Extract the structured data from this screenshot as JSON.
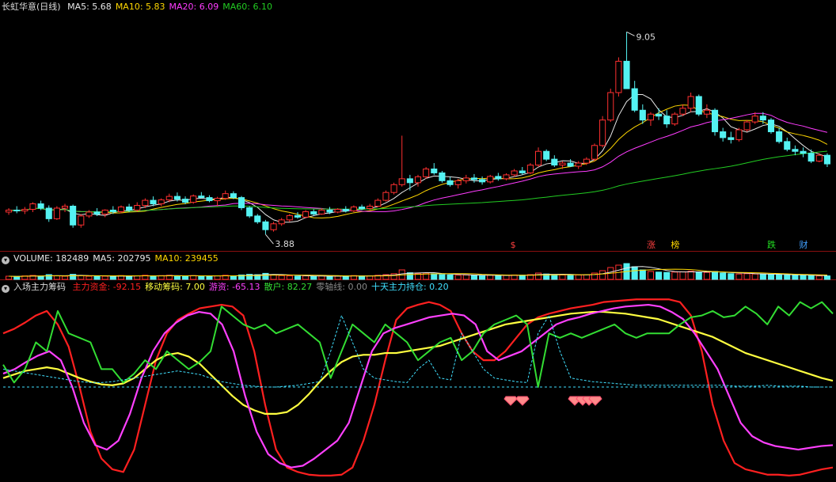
{
  "price_panel": {
    "title": "长虹华意(日线)",
    "indicators": [
      {
        "label": "MA5: 5.68",
        "color": "#e8e8e8"
      },
      {
        "label": "MA10: 5.83",
        "color": "#ffd700"
      },
      {
        "label": "MA20: 6.09",
        "color": "#ff3cff"
      },
      {
        "label": "MA60: 6.10",
        "color": "#22cc22"
      }
    ],
    "high_label": "9.05",
    "low_label": "3.88",
    "markers": [
      {
        "text": "$",
        "color": "#ff4040"
      },
      {
        "text": "涨",
        "color": "#ff4040"
      },
      {
        "text": "榜",
        "color": "#ffd700"
      },
      {
        "text": "跌",
        "color": "#22dd22"
      },
      {
        "text": "财",
        "color": "#40a0ff"
      }
    ]
  },
  "volume_panel": {
    "items": [
      {
        "label": "VOLUME: 182489",
        "color": "#e8e8e8"
      },
      {
        "label": "MA5: 202795",
        "color": "#e8e8e8"
      },
      {
        "label": "MA10: 239455",
        "color": "#ffd700"
      }
    ]
  },
  "indicator_panel": {
    "title": "入场主力筹码",
    "items": [
      {
        "label": "主力资金: -92.15",
        "color": "#ff2020"
      },
      {
        "label": "移动筹码: 7.00",
        "color": "#ffff40"
      },
      {
        "label": "游资: -65.13",
        "color": "#ff40ff"
      },
      {
        "label": "散户: 82.27",
        "color": "#33dd33"
      },
      {
        "label": "零轴线: 0.00",
        "color": "#888888"
      },
      {
        "label": "十天主力持仓: 0.20",
        "color": "#40e0ff"
      }
    ]
  },
  "colors": {
    "up": "#ff3030",
    "down": "#54f2f2",
    "background": "#000000",
    "separator": "#8a1010"
  },
  "chart_data": [
    {
      "type": "candlestick",
      "name": "price",
      "ylim": [
        3.6,
        9.5
      ],
      "candles_ohlc_approx": [
        [
          4.45,
          4.55,
          4.38,
          4.5
        ],
        [
          4.5,
          4.6,
          4.42,
          4.48
        ],
        [
          4.48,
          4.58,
          4.4,
          4.52
        ],
        [
          4.52,
          4.7,
          4.45,
          4.66
        ],
        [
          4.66,
          4.74,
          4.5,
          4.55
        ],
        [
          4.55,
          4.62,
          4.2,
          4.28
        ],
        [
          4.28,
          4.6,
          4.25,
          4.55
        ],
        [
          4.55,
          4.66,
          4.45,
          4.6
        ],
        [
          4.6,
          4.64,
          4.05,
          4.12
        ],
        [
          4.12,
          4.4,
          4.05,
          4.35
        ],
        [
          4.35,
          4.5,
          4.3,
          4.45
        ],
        [
          4.45,
          4.55,
          4.35,
          4.4
        ],
        [
          4.4,
          4.52,
          4.32,
          4.5
        ],
        [
          4.5,
          4.6,
          4.4,
          4.46
        ],
        [
          4.46,
          4.62,
          4.42,
          4.58
        ],
        [
          4.58,
          4.66,
          4.45,
          4.5
        ],
        [
          4.5,
          4.7,
          4.46,
          4.62
        ],
        [
          4.62,
          4.8,
          4.55,
          4.75
        ],
        [
          4.75,
          4.85,
          4.6,
          4.66
        ],
        [
          4.66,
          4.8,
          4.6,
          4.76
        ],
        [
          4.76,
          4.92,
          4.7,
          4.85
        ],
        [
          4.85,
          4.95,
          4.72,
          4.78
        ],
        [
          4.78,
          4.85,
          4.65,
          4.7
        ],
        [
          4.7,
          4.9,
          4.66,
          4.86
        ],
        [
          4.86,
          4.96,
          4.8,
          4.82
        ],
        [
          4.82,
          4.88,
          4.7,
          4.74
        ],
        [
          4.74,
          4.84,
          4.6,
          4.8
        ],
        [
          4.8,
          5.0,
          4.76,
          4.92
        ],
        [
          4.92,
          4.98,
          4.78,
          4.82
        ],
        [
          4.82,
          4.86,
          4.5,
          4.56
        ],
        [
          4.56,
          4.6,
          4.3,
          4.35
        ],
        [
          4.35,
          4.4,
          4.15,
          4.2
        ],
        [
          4.2,
          4.25,
          3.88,
          4.0
        ],
        [
          4.0,
          4.2,
          3.95,
          4.15
        ],
        [
          4.15,
          4.3,
          4.1,
          4.25
        ],
        [
          4.25,
          4.4,
          4.2,
          4.36
        ],
        [
          4.36,
          4.45,
          4.28,
          4.32
        ],
        [
          4.32,
          4.5,
          4.3,
          4.46
        ],
        [
          4.46,
          4.52,
          4.35,
          4.4
        ],
        [
          4.4,
          4.55,
          4.38,
          4.5
        ],
        [
          4.5,
          4.58,
          4.4,
          4.45
        ],
        [
          4.45,
          4.55,
          4.42,
          4.52
        ],
        [
          4.52,
          4.6,
          4.44,
          4.48
        ],
        [
          4.48,
          4.62,
          4.45,
          4.58
        ],
        [
          4.58,
          4.64,
          4.5,
          4.54
        ],
        [
          4.54,
          4.66,
          4.5,
          4.6
        ],
        [
          4.6,
          4.8,
          4.58,
          4.75
        ],
        [
          4.75,
          5.0,
          4.72,
          4.95
        ],
        [
          4.95,
          5.2,
          4.9,
          5.15
        ],
        [
          5.15,
          6.4,
          5.1,
          5.3
        ],
        [
          5.3,
          5.4,
          5.0,
          5.2
        ],
        [
          5.2,
          5.4,
          5.1,
          5.35
        ],
        [
          5.35,
          5.6,
          5.3,
          5.55
        ],
        [
          5.55,
          5.7,
          5.4,
          5.45
        ],
        [
          5.45,
          5.5,
          5.2,
          5.25
        ],
        [
          5.25,
          5.35,
          5.1,
          5.15
        ],
        [
          5.15,
          5.3,
          5.05,
          5.25
        ],
        [
          5.25,
          5.4,
          5.18,
          5.32
        ],
        [
          5.32,
          5.42,
          5.2,
          5.28
        ],
        [
          5.28,
          5.36,
          5.15,
          5.22
        ],
        [
          5.22,
          5.4,
          5.18,
          5.36
        ],
        [
          5.36,
          5.45,
          5.25,
          5.3
        ],
        [
          5.3,
          5.44,
          5.26,
          5.4
        ],
        [
          5.4,
          5.55,
          5.35,
          5.5
        ],
        [
          5.5,
          5.6,
          5.4,
          5.45
        ],
        [
          5.45,
          5.7,
          5.42,
          5.65
        ],
        [
          5.65,
          6.1,
          5.6,
          6.0
        ],
        [
          6.0,
          6.05,
          5.75,
          5.8
        ],
        [
          5.8,
          5.9,
          5.6,
          5.65
        ],
        [
          5.65,
          5.75,
          5.55,
          5.7
        ],
        [
          5.7,
          5.8,
          5.6,
          5.62
        ],
        [
          5.62,
          5.75,
          5.55,
          5.7
        ],
        [
          5.7,
          5.85,
          5.65,
          5.8
        ],
        [
          5.8,
          6.2,
          5.75,
          6.15
        ],
        [
          6.15,
          6.9,
          6.1,
          6.8
        ],
        [
          6.8,
          7.6,
          6.75,
          7.5
        ],
        [
          7.5,
          8.4,
          7.4,
          8.3
        ],
        [
          8.3,
          9.05,
          8.2,
          7.6
        ],
        [
          7.6,
          7.8,
          7.0,
          7.05
        ],
        [
          7.05,
          7.2,
          6.7,
          6.8
        ],
        [
          6.8,
          7.0,
          6.65,
          6.95
        ],
        [
          6.95,
          7.1,
          6.8,
          6.9
        ],
        [
          6.9,
          7.05,
          6.6,
          6.7
        ],
        [
          6.7,
          7.0,
          6.65,
          6.95
        ],
        [
          6.95,
          7.2,
          6.9,
          7.1
        ],
        [
          7.1,
          7.5,
          7.0,
          7.4
        ],
        [
          7.4,
          7.45,
          6.9,
          6.95
        ],
        [
          6.95,
          7.2,
          6.85,
          7.05
        ],
        [
          7.05,
          7.1,
          6.4,
          6.5
        ],
        [
          6.5,
          6.6,
          6.25,
          6.35
        ],
        [
          6.35,
          6.5,
          6.2,
          6.3
        ],
        [
          6.3,
          6.6,
          6.25,
          6.55
        ],
        [
          6.55,
          6.8,
          6.5,
          6.75
        ],
        [
          6.75,
          7.0,
          6.7,
          6.9
        ],
        [
          6.9,
          7.0,
          6.7,
          6.8
        ],
        [
          6.8,
          6.85,
          6.45,
          6.5
        ],
        [
          6.5,
          6.6,
          6.2,
          6.25
        ],
        [
          6.25,
          6.35,
          6.0,
          6.05
        ],
        [
          6.05,
          6.15,
          5.9,
          6.0
        ],
        [
          6.0,
          6.1,
          5.85,
          5.95
        ],
        [
          5.95,
          6.05,
          5.7,
          5.75
        ],
        [
          5.75,
          5.95,
          5.72,
          5.9
        ],
        [
          5.9,
          5.95,
          5.6,
          5.68
        ]
      ]
    },
    {
      "type": "bar",
      "name": "volume",
      "values_relative": [
        0.2,
        0.18,
        0.22,
        0.25,
        0.2,
        0.3,
        0.22,
        0.2,
        0.32,
        0.24,
        0.2,
        0.18,
        0.2,
        0.22,
        0.24,
        0.2,
        0.22,
        0.26,
        0.22,
        0.24,
        0.26,
        0.22,
        0.2,
        0.24,
        0.22,
        0.2,
        0.22,
        0.26,
        0.22,
        0.28,
        0.32,
        0.3,
        0.38,
        0.28,
        0.24,
        0.22,
        0.2,
        0.22,
        0.2,
        0.22,
        0.2,
        0.2,
        0.22,
        0.24,
        0.22,
        0.22,
        0.26,
        0.3,
        0.36,
        0.6,
        0.42,
        0.36,
        0.4,
        0.36,
        0.3,
        0.28,
        0.26,
        0.28,
        0.26,
        0.24,
        0.26,
        0.24,
        0.26,
        0.28,
        0.26,
        0.3,
        0.4,
        0.34,
        0.3,
        0.28,
        0.26,
        0.28,
        0.3,
        0.4,
        0.55,
        0.75,
        0.9,
        1.0,
        0.8,
        0.6,
        0.5,
        0.46,
        0.44,
        0.46,
        0.48,
        0.52,
        0.46,
        0.44,
        0.5,
        0.4,
        0.36,
        0.34,
        0.36,
        0.34,
        0.32,
        0.3,
        0.3,
        0.28,
        0.26,
        0.26,
        0.24,
        0.22,
        0.22
      ]
    },
    {
      "type": "line",
      "name": "indicator",
      "ylim": [
        -100,
        100
      ],
      "series": [
        {
          "name": "主力资金",
          "color": "#ff2020",
          "values": [
            60,
            65,
            72,
            80,
            85,
            70,
            45,
            0,
            -50,
            -80,
            -92,
            -95,
            -70,
            -20,
            30,
            60,
            75,
            82,
            88,
            90,
            92,
            90,
            80,
            40,
            -20,
            -70,
            -90,
            -95,
            -98,
            -99,
            -99,
            -98,
            -90,
            -60,
            -20,
            30,
            75,
            88,
            92,
            95,
            92,
            85,
            60,
            40,
            30,
            30,
            40,
            55,
            70,
            78,
            82,
            85,
            88,
            90,
            92,
            95,
            96,
            97,
            98,
            98,
            98,
            98,
            95,
            80,
            40,
            -20,
            -60,
            -85,
            -92,
            -95,
            -98,
            -98,
            -99,
            -98,
            -95,
            -92,
            -90
          ]
        },
        {
          "name": "移动筹码",
          "color": "#ffff40",
          "values": [
            10,
            14,
            18,
            20,
            22,
            20,
            15,
            10,
            6,
            3,
            2,
            4,
            10,
            20,
            30,
            36,
            38,
            34,
            26,
            14,
            2,
            -10,
            -20,
            -26,
            -30,
            -30,
            -28,
            -20,
            -8,
            6,
            18,
            28,
            34,
            36,
            36,
            38,
            38,
            40,
            42,
            44,
            46,
            50,
            54,
            58,
            62,
            66,
            70,
            72,
            74,
            76,
            78,
            80,
            82,
            83,
            84,
            84,
            83,
            82,
            80,
            78,
            76,
            72,
            68,
            64,
            60,
            56,
            50,
            44,
            38,
            34,
            30,
            26,
            22,
            18,
            14,
            10,
            7
          ]
        },
        {
          "name": "游资",
          "color": "#ff40ff",
          "values": [
            15,
            20,
            28,
            35,
            40,
            30,
            0,
            -40,
            -65,
            -70,
            -60,
            -30,
            10,
            40,
            60,
            72,
            80,
            84,
            82,
            70,
            40,
            -10,
            -50,
            -75,
            -85,
            -90,
            -88,
            -80,
            -70,
            -60,
            -40,
            0,
            40,
            60,
            66,
            70,
            74,
            78,
            80,
            82,
            80,
            70,
            40,
            30,
            35,
            40,
            50,
            60,
            70,
            75,
            78,
            82,
            85,
            88,
            90,
            91,
            92,
            90,
            84,
            76,
            60,
            40,
            20,
            -10,
            -40,
            -55,
            -62,
            -66,
            -68,
            -70,
            -68,
            -66,
            -65
          ]
        },
        {
          "name": "散户",
          "color": "#33dd33",
          "values": [
            25,
            5,
            20,
            50,
            40,
            85,
            60,
            55,
            50,
            20,
            20,
            5,
            15,
            30,
            20,
            40,
            30,
            20,
            28,
            40,
            90,
            80,
            70,
            65,
            70,
            60,
            65,
            70,
            60,
            50,
            10,
            40,
            70,
            60,
            50,
            70,
            60,
            50,
            30,
            40,
            50,
            55,
            30,
            40,
            60,
            70,
            75,
            80,
            70,
            0,
            60,
            55,
            60,
            55,
            60,
            65,
            70,
            60,
            55,
            60,
            60,
            60,
            70,
            78,
            80,
            85,
            78,
            80,
            90,
            82,
            70,
            90,
            80,
            95,
            88,
            95,
            82
          ]
        },
        {
          "name": "零轴线",
          "color": "#888888",
          "values": [
            0,
            0
          ]
        },
        {
          "name": "十天主力持仓",
          "color": "#40e0ff",
          "values": [
            20,
            18,
            16,
            14,
            12,
            10,
            8,
            6,
            5,
            5,
            6,
            8,
            10,
            12,
            14,
            16,
            18,
            16,
            14,
            10,
            6,
            4,
            2,
            1,
            0,
            0,
            1,
            2,
            4,
            6,
            40,
            80,
            50,
            20,
            10,
            8,
            6,
            5,
            20,
            30,
            10,
            8,
            60,
            40,
            20,
            10,
            8,
            6,
            5,
            60,
            80,
            40,
            10,
            8,
            6,
            5,
            4,
            3,
            2,
            2,
            2,
            2,
            2,
            2,
            2,
            2,
            2,
            1,
            1,
            1,
            2,
            1,
            1,
            1,
            0,
            0,
            0
          ]
        }
      ]
    }
  ]
}
